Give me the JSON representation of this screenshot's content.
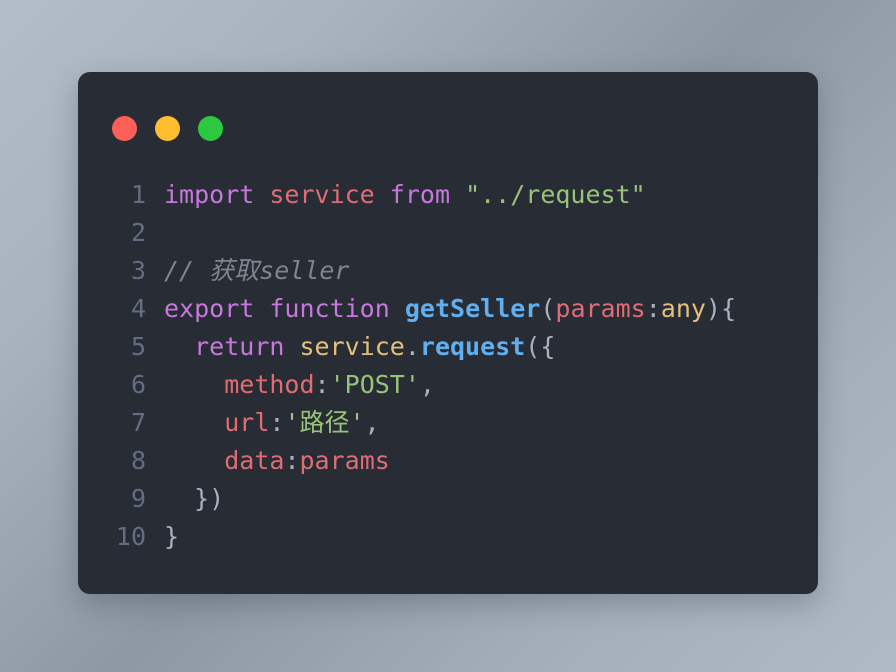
{
  "window": {
    "title": "code-snippet",
    "dots": [
      {
        "name": "close",
        "color": "#fc5f58",
        "label": ""
      },
      {
        "name": "minimize",
        "color": "#fdbd2e",
        "label": ""
      },
      {
        "name": "maximize",
        "color": "#2bc840",
        "label": ""
      }
    ]
  },
  "theme": {
    "card_background": "#282c34",
    "page_background": "#a8b3bf",
    "gutter_color": "#636d83",
    "default_text": "#abb2bf",
    "keyword": "#c678dd",
    "variable": "#e06c75",
    "string": "#98c379",
    "function": "#61afef",
    "property": "#e5c07b",
    "type": "#e5c07b",
    "comment": "#7f848e"
  },
  "editor": {
    "language": "typescript",
    "line_numbers": [
      "1",
      "2",
      "3",
      "4",
      "5",
      "6",
      "7",
      "8",
      "9",
      "10"
    ],
    "plain_code": "import service from \"../request\"\n\n// 获取seller\nexport function getSeller(params:any){\n  return service.request({\n    method:'POST',\n    url:'路径',\n    data:params\n  })\n}",
    "lines": [
      {
        "number": "1",
        "tokens": [
          {
            "t": "import",
            "c": "keyword"
          },
          {
            "t": " ",
            "c": "plain"
          },
          {
            "t": "service",
            "c": "variable"
          },
          {
            "t": " ",
            "c": "plain"
          },
          {
            "t": "from",
            "c": "keyword"
          },
          {
            "t": " ",
            "c": "plain"
          },
          {
            "t": "\"../request\"",
            "c": "string"
          }
        ]
      },
      {
        "number": "2",
        "tokens": []
      },
      {
        "number": "3",
        "tokens": [
          {
            "t": "// 获取seller",
            "c": "comment"
          }
        ]
      },
      {
        "number": "4",
        "tokens": [
          {
            "t": "export",
            "c": "keyword"
          },
          {
            "t": " ",
            "c": "plain"
          },
          {
            "t": "function",
            "c": "keyword"
          },
          {
            "t": " ",
            "c": "plain"
          },
          {
            "t": "getSeller",
            "c": "function"
          },
          {
            "t": "(",
            "c": "punct"
          },
          {
            "t": "params",
            "c": "variable"
          },
          {
            "t": ":",
            "c": "punct"
          },
          {
            "t": "any",
            "c": "type"
          },
          {
            "t": "){",
            "c": "punct"
          }
        ]
      },
      {
        "number": "5",
        "tokens": [
          {
            "t": "  ",
            "c": "plain"
          },
          {
            "t": "return",
            "c": "keyword"
          },
          {
            "t": " ",
            "c": "plain"
          },
          {
            "t": "service",
            "c": "property"
          },
          {
            "t": ".",
            "c": "punct"
          },
          {
            "t": "request",
            "c": "function"
          },
          {
            "t": "({",
            "c": "punct"
          }
        ]
      },
      {
        "number": "6",
        "tokens": [
          {
            "t": "    ",
            "c": "plain"
          },
          {
            "t": "method",
            "c": "variable"
          },
          {
            "t": ":",
            "c": "punct"
          },
          {
            "t": "'POST'",
            "c": "string"
          },
          {
            "t": ",",
            "c": "punct"
          }
        ]
      },
      {
        "number": "7",
        "tokens": [
          {
            "t": "    ",
            "c": "plain"
          },
          {
            "t": "url",
            "c": "variable"
          },
          {
            "t": ":",
            "c": "punct"
          },
          {
            "t": "'路径'",
            "c": "string"
          },
          {
            "t": ",",
            "c": "punct"
          }
        ]
      },
      {
        "number": "8",
        "tokens": [
          {
            "t": "    ",
            "c": "plain"
          },
          {
            "t": "data",
            "c": "variable"
          },
          {
            "t": ":",
            "c": "punct"
          },
          {
            "t": "params",
            "c": "variable"
          }
        ]
      },
      {
        "number": "9",
        "tokens": [
          {
            "t": "  ",
            "c": "plain"
          },
          {
            "t": "})",
            "c": "punct"
          }
        ]
      },
      {
        "number": "10",
        "tokens": [
          {
            "t": "}",
            "c": "punct"
          }
        ]
      }
    ]
  }
}
